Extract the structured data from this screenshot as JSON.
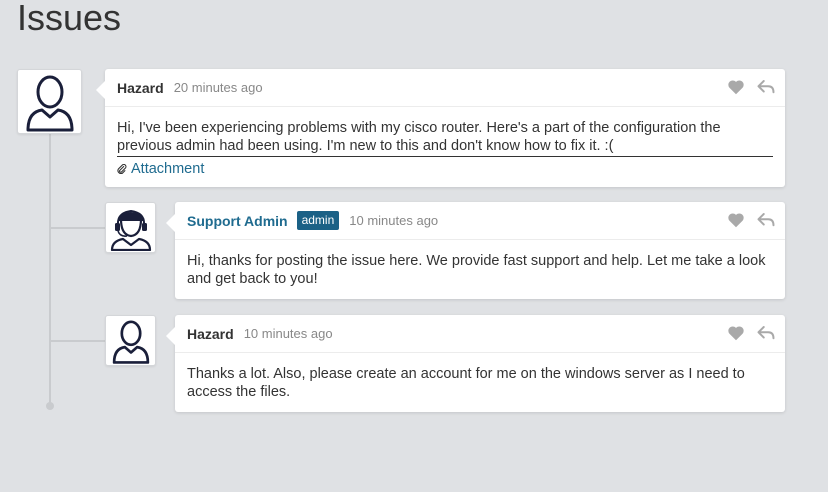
{
  "page_title": "Issues",
  "posts": [
    {
      "author": "Hazard",
      "time": "20 minutes ago",
      "message": "Hi, I've been experiencing problems with my cisco router. Here's a part of the configuration the previous admin had been using. I'm new to this and don't know how to fix it. :(",
      "attachment_label": "Attachment"
    },
    {
      "author": "Support Admin",
      "badge": "admin",
      "time": "10 minutes ago",
      "message": "Hi, thanks for posting the issue here. We provide fast support and help. Let me take a look and get back to you!"
    },
    {
      "author": "Hazard",
      "time": "10 minutes ago",
      "message": "Thanks a lot. Also, please create an account for me on the windows server as I need to access the files."
    }
  ],
  "icons": {
    "like": "heart-icon",
    "reply": "reply-icon",
    "attachment": "paperclip-icon",
    "user_avatar": "user-avatar-icon",
    "support_avatar": "support-agent-avatar-icon"
  },
  "colors": {
    "background": "#dfe1e4",
    "accent": "#1f6b8f",
    "badge": "#1b6186"
  }
}
